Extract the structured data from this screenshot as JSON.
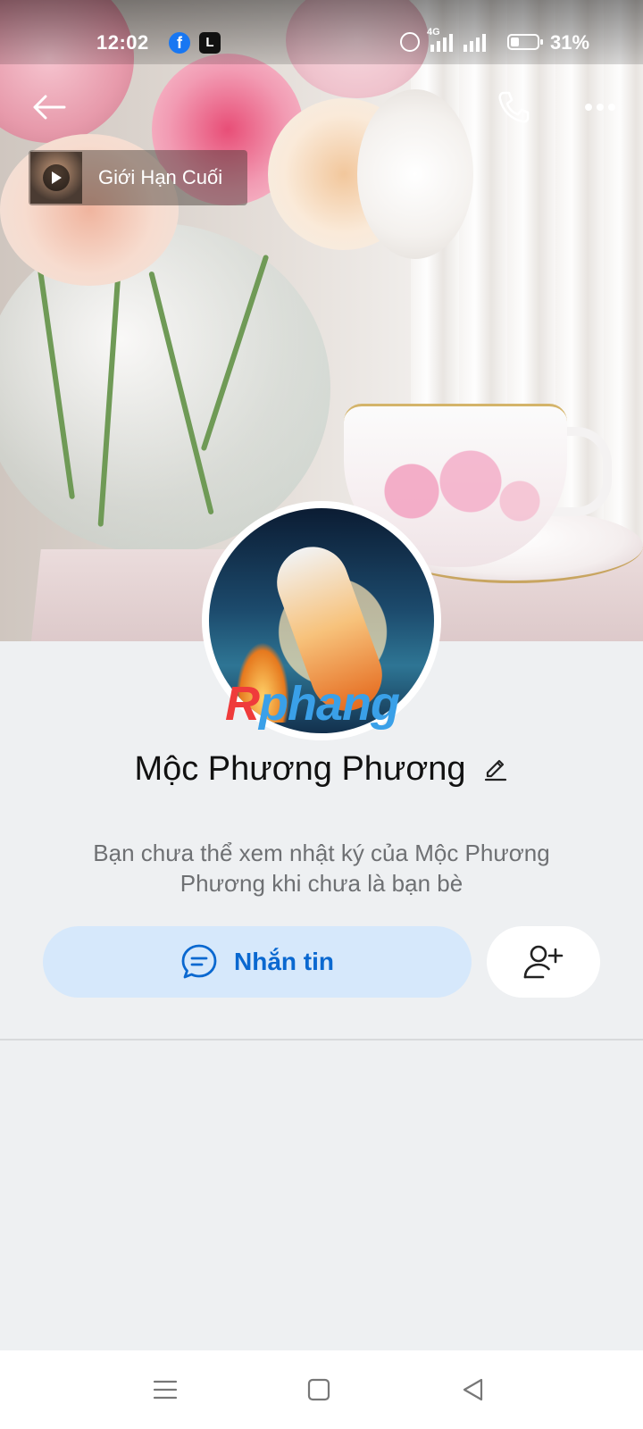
{
  "status_bar": {
    "time": "12:02",
    "network_label": "4G",
    "battery_percent": "31%",
    "battery_level": 0.31
  },
  "header": {
    "back_icon": "arrow-left-icon",
    "call_icon": "phone-icon",
    "more_icon": "more-dots-icon"
  },
  "music": {
    "title": "Giới Hạn Cuối"
  },
  "profile": {
    "name": "Mộc Phương Phương",
    "watermark": {
      "first": "R",
      "rest": "phang"
    },
    "diary_message": "Bạn chưa thể xem nhật ký của Mộc Phương Phương khi chưa là bạn bè"
  },
  "actions": {
    "message_label": "Nhắn tin",
    "message_icon": "chat-bubble-icon",
    "add_friend_icon": "add-friend-icon"
  },
  "colors": {
    "accent": "#0a68d0",
    "message_button_bg": "#d6e8fb",
    "page_bg": "#eef0f2"
  }
}
